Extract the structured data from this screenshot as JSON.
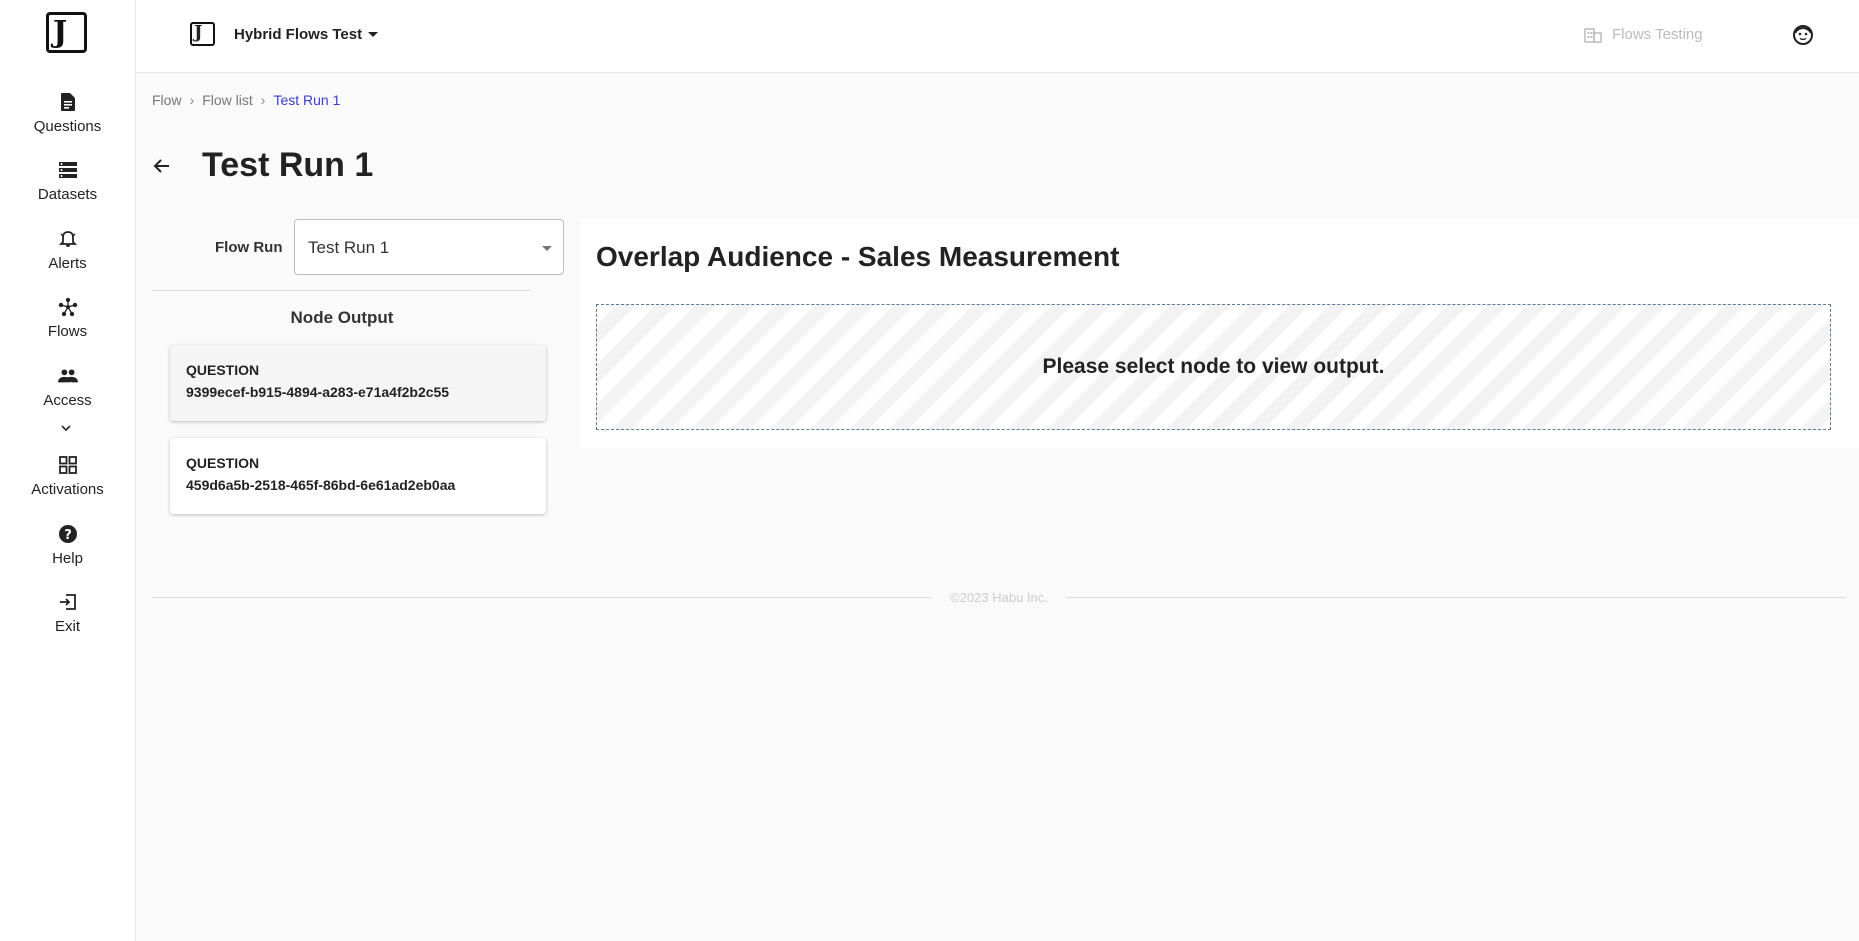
{
  "sidebar": {
    "items": [
      {
        "label": "Questions",
        "icon": "document-icon"
      },
      {
        "label": "Datasets",
        "icon": "list-icon"
      },
      {
        "label": "Alerts",
        "icon": "bell-icon"
      },
      {
        "label": "Flows",
        "icon": "flows-icon"
      },
      {
        "label": "Access",
        "icon": "people-icon"
      },
      {
        "label": "Activations",
        "icon": "grid-icon"
      },
      {
        "label": "Help",
        "icon": "help-icon"
      },
      {
        "label": "Exit",
        "icon": "exit-icon"
      }
    ]
  },
  "header": {
    "org_name": "Hybrid Flows Test",
    "workspace": "Flows Testing"
  },
  "breadcrumb": [
    "Flow",
    "Flow list",
    "Test Run 1"
  ],
  "page": {
    "title": "Test Run 1"
  },
  "flow_run": {
    "label": "Flow Run",
    "selected": "Test Run 1"
  },
  "node_output": {
    "title": "Node Output",
    "nodes": [
      {
        "type": "QUESTION",
        "id": "9399ecef-b915-4894-a283-e71a4f2b2c55"
      },
      {
        "type": "QUESTION",
        "id": "459d6a5b-2518-465f-86bd-6e61ad2eb0aa"
      }
    ]
  },
  "output_panel": {
    "title": "Overlap Audience - Sales Measurement",
    "placeholder": "Please select node to view output."
  },
  "footer": {
    "copyright": "©2023 Habu Inc."
  },
  "colors": {
    "accent_link": "#3b3bd6",
    "placeholder_border": "#5a7a96"
  }
}
